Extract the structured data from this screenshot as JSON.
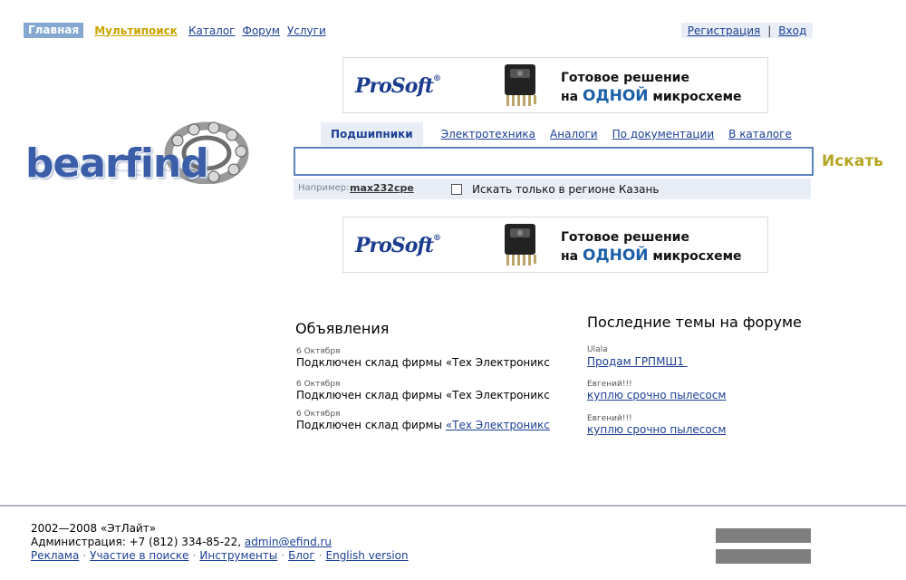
{
  "nav": {
    "home": "Главная",
    "multisearch": "Мультипоиск",
    "catalog": "Каталог",
    "forum": "Форум",
    "services": "Услуги",
    "register": "Регистрация",
    "separator": "|",
    "login": "Вход"
  },
  "banner": {
    "brand": "ProSoft",
    "line1": "Готовое решение",
    "line2_prefix": "на",
    "line2_highlight": "ОДНОЙ",
    "line2_suffix": "микросхеме"
  },
  "logo": {
    "text": "bearfind"
  },
  "search": {
    "tabs": [
      "Подшипники",
      "Электротехника",
      "Аналоги",
      "По документации",
      "В каталоге"
    ],
    "input_value": "",
    "button": "Искать",
    "example_label": "Например:",
    "example_value": "max232cpe",
    "region_checkbox_label": "Искать только в регионе Казань"
  },
  "announcements": {
    "title": "Объявления",
    "items": [
      {
        "date": "6 Октября",
        "text": "Подключен склад фирмы «Тех Электроникс"
      },
      {
        "date": "6 Октября",
        "text": "Подключен склад фирмы «Тех Электроникс"
      },
      {
        "date": "6 Октября",
        "text_prefix": "Подключен склад фирмы ",
        "link": "«Тех Электроникс"
      }
    ]
  },
  "forum": {
    "title": "Последние темы на форуме",
    "items": [
      {
        "author": "Ulala",
        "topic": "Продам ГРПМШ1 "
      },
      {
        "author": "Евгений!!!",
        "topic": "куплю срочно пылесосм"
      },
      {
        "author": "Евгений!!!",
        "topic": "куплю срочно пылесосм"
      }
    ]
  },
  "footer": {
    "copyright": "2002—2008 «ЭтЛайт»",
    "admin_prefix": "Администрация: +7 (812) 334-85-22, ",
    "admin_email": "admin@efind.ru",
    "links": [
      "Реклама",
      "Участие в поиске",
      "Инструменты",
      "Блог",
      "English version"
    ],
    "link_separator": "·"
  },
  "colors": {
    "accent_blue": "#1c3f95",
    "home_tab_bg": "#84a8d2",
    "multisearch": "#c9a300",
    "search_button": "#b5a622",
    "light_panel": "#e9eef6",
    "input_border": "#5b84bd",
    "counter_gray": "#7f7f7f"
  }
}
